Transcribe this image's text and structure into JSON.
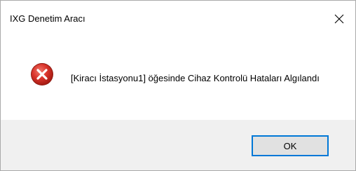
{
  "window": {
    "title": "IXG Denetim Aracı",
    "close_icon": "close-icon"
  },
  "dialog": {
    "icon": "error-icon",
    "icon_color": "#d9342b",
    "message": "[Kiracı İstasyonu1] öğesinde Cihaz Kontrolü Hataları Algılandı"
  },
  "footer": {
    "ok_label": "OK",
    "accent": "#0078d7"
  }
}
